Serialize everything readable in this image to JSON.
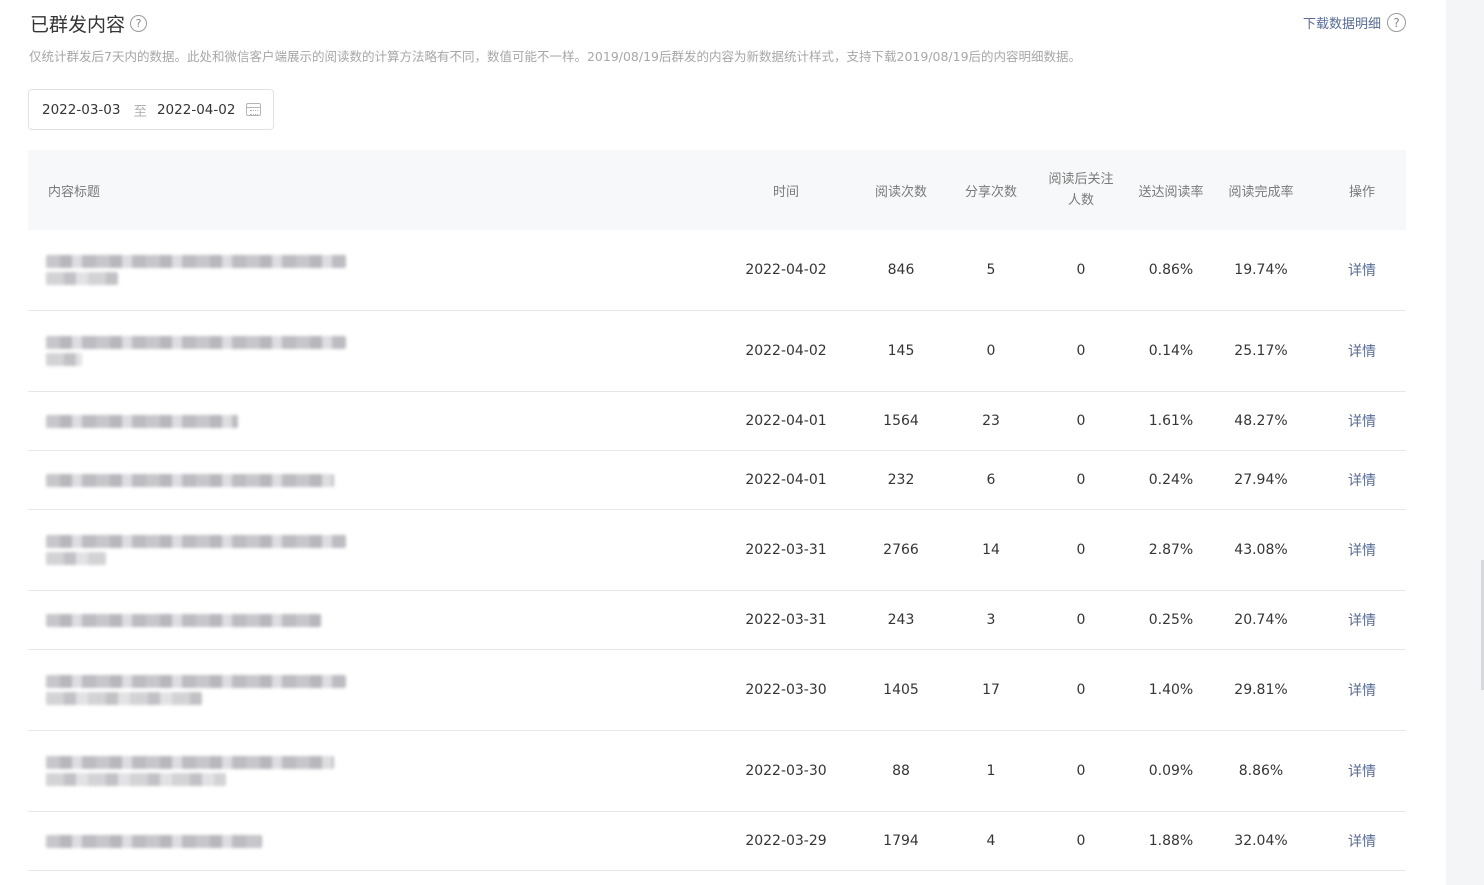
{
  "header": {
    "title": "已群发内容",
    "help_icon": "question-circle-icon",
    "download_label": "下载数据明细",
    "note": "仅统计群发后7天内的数据。此处和微信客户端展示的阅读数的计算方法略有不同，数值可能不一样。2019/08/19后群发的内容为新数据统计样式，支持下载2019/08/19后的内容明细数据。"
  },
  "date_range": {
    "start": "2022-03-03",
    "separator": "至",
    "end": "2022-04-02",
    "icon": "calendar-icon"
  },
  "table": {
    "columns": {
      "title": "内容标题",
      "time": "时间",
      "reads": "阅读次数",
      "shares": "分享次数",
      "follow_line1": "阅读后关注",
      "follow_line2": "人数",
      "delivery_rate": "送达阅读率",
      "completion_rate": "阅读完成率",
      "action": "操作"
    },
    "rows": [
      {
        "time": "2022-04-02",
        "reads": "846",
        "shares": "5",
        "follow": "0",
        "delivery_rate": "0.86%",
        "completion_rate": "19.74%",
        "action": "详情"
      },
      {
        "time": "2022-04-02",
        "reads": "145",
        "shares": "0",
        "follow": "0",
        "delivery_rate": "0.14%",
        "completion_rate": "25.17%",
        "action": "详情"
      },
      {
        "time": "2022-04-01",
        "reads": "1564",
        "shares": "23",
        "follow": "0",
        "delivery_rate": "1.61%",
        "completion_rate": "48.27%",
        "action": "详情"
      },
      {
        "time": "2022-04-01",
        "reads": "232",
        "shares": "6",
        "follow": "0",
        "delivery_rate": "0.24%",
        "completion_rate": "27.94%",
        "action": "详情"
      },
      {
        "time": "2022-03-31",
        "reads": "2766",
        "shares": "14",
        "follow": "0",
        "delivery_rate": "2.87%",
        "completion_rate": "43.08%",
        "action": "详情"
      },
      {
        "time": "2022-03-31",
        "reads": "243",
        "shares": "3",
        "follow": "0",
        "delivery_rate": "0.25%",
        "completion_rate": "20.74%",
        "action": "详情"
      },
      {
        "time": "2022-03-30",
        "reads": "1405",
        "shares": "17",
        "follow": "0",
        "delivery_rate": "1.40%",
        "completion_rate": "29.81%",
        "action": "详情"
      },
      {
        "time": "2022-03-30",
        "reads": "88",
        "shares": "1",
        "follow": "0",
        "delivery_rate": "0.09%",
        "completion_rate": "8.86%",
        "action": "详情"
      },
      {
        "time": "2022-03-29",
        "reads": "1794",
        "shares": "4",
        "follow": "0",
        "delivery_rate": "1.88%",
        "completion_rate": "32.04%",
        "action": "详情"
      }
    ]
  },
  "colors": {
    "link": "#576b95",
    "header_bg": "#f6f8f9",
    "muted_text": "#a7a7a7"
  }
}
